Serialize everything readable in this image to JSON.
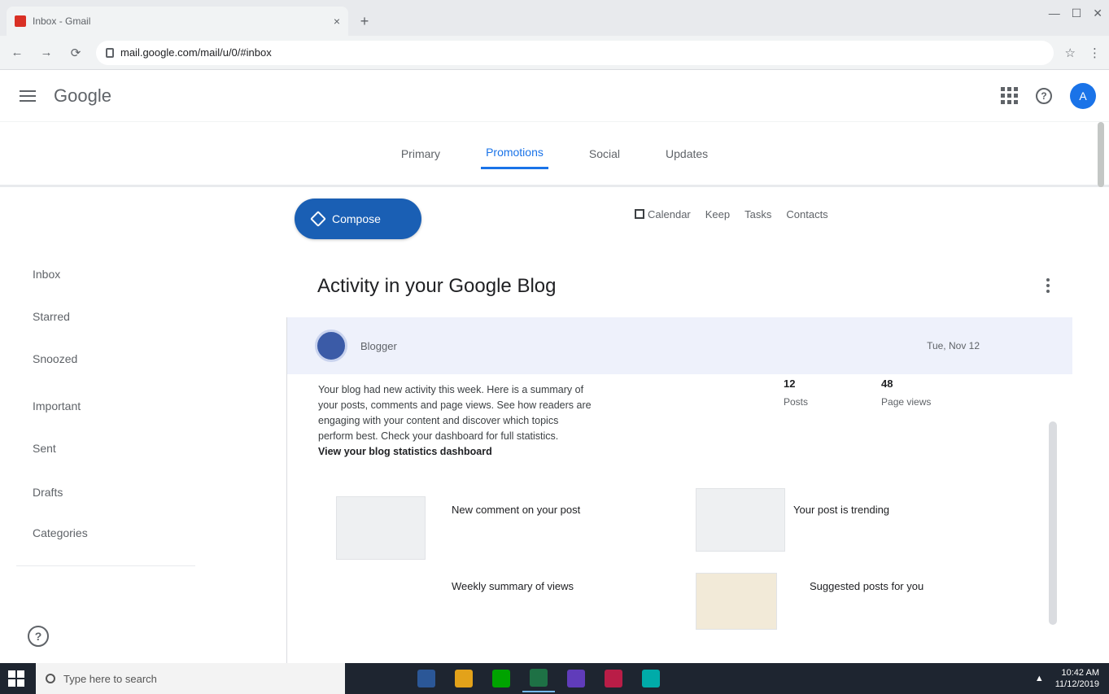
{
  "browser": {
    "tab_title": "Inbox - Gmail",
    "new_tab": "+",
    "tab_close": "×",
    "window_controls": [
      "—",
      "☐",
      "✕"
    ],
    "address": "mail.google.com/mail/u/0/#inbox",
    "nav": {
      "back": "←",
      "forward": "→",
      "reload": "⟳"
    },
    "toolbar_right": [
      "☆",
      "⋮"
    ]
  },
  "gmail": {
    "logo": "Google",
    "avatar_letter": "A",
    "help": "?"
  },
  "categories": [
    {
      "label": "Primary",
      "active": false
    },
    {
      "label": "Promotions",
      "active": true
    },
    {
      "label": "Social",
      "active": false
    },
    {
      "label": "Updates",
      "active": false
    }
  ],
  "sidebar": {
    "items": [
      "Inbox",
      "Starred",
      "Snoozed",
      "Important",
      "Sent",
      "Drafts",
      "Categories"
    ],
    "support": "?"
  },
  "main": {
    "compose_label": "Compose",
    "actions": [
      "Calendar",
      "Keep",
      "Tasks",
      "Contacts"
    ],
    "message_title": "Activity in your Google Blog",
    "sender_name": "Blogger",
    "sender_date": "Tue, Nov 12",
    "body_lines": [
      "Your blog had new activity this week. Here is a summary of",
      "your posts, comments and page views. See how readers are",
      "engaging with your content and discover which topics",
      "perform best. Check your dashboard for full statistics."
    ],
    "body_link": "View your blog statistics dashboard",
    "stats": [
      {
        "num": "12",
        "label": "Posts"
      },
      {
        "num": "48",
        "label": "Page views"
      }
    ],
    "cards": [
      "New comment on your post",
      "Your post is trending",
      "Weekly summary of views",
      "Suggested posts for you"
    ]
  },
  "taskbar": {
    "search_placeholder": "Type here to search",
    "time": "10:42 AM",
    "date": "11/12/2019",
    "app_colors": [
      "#2b5797",
      "#e3a21a",
      "#00a300",
      "#1e7145",
      "#603cba",
      "#b91d47",
      "#00aba9"
    ]
  }
}
